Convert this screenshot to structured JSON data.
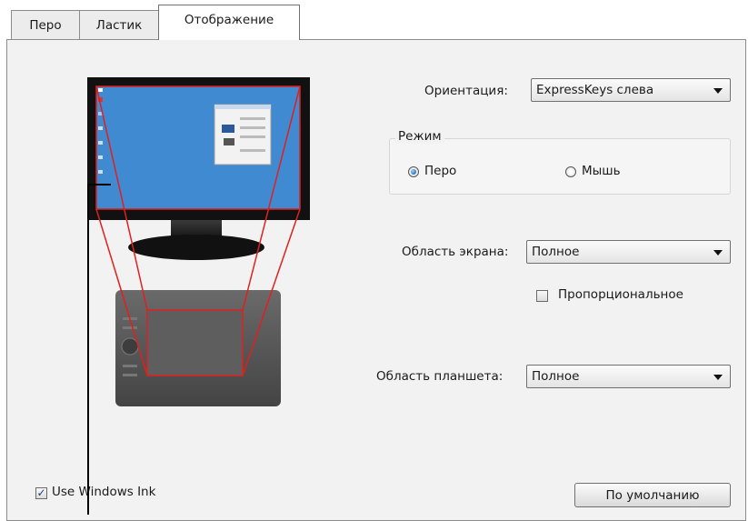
{
  "tabs": [
    {
      "label": "Перо"
    },
    {
      "label": "Ластик"
    },
    {
      "label": "Отображение"
    }
  ],
  "orientation": {
    "label": "Ориентация:",
    "value": "ExpressKeys слева"
  },
  "mode": {
    "legend": "Режим",
    "pen_label": "Перо",
    "mouse_label": "Мышь",
    "selected": "pen"
  },
  "screen_area": {
    "label": "Область экрана:",
    "value": "Полное"
  },
  "proportional": {
    "label": "Пропорциональное",
    "checked": false
  },
  "tablet_area": {
    "label": "Область планшета:",
    "value": "Полное"
  },
  "windows_ink": {
    "label": "Use Windows Ink",
    "checked": true
  },
  "default_button": {
    "label": "По умолчанию"
  },
  "colors": {
    "desktop_blue": "#3f8ad0",
    "mapping_red": "#e0201e",
    "monitor_frame": "#111111",
    "tablet_body": "#575757"
  }
}
